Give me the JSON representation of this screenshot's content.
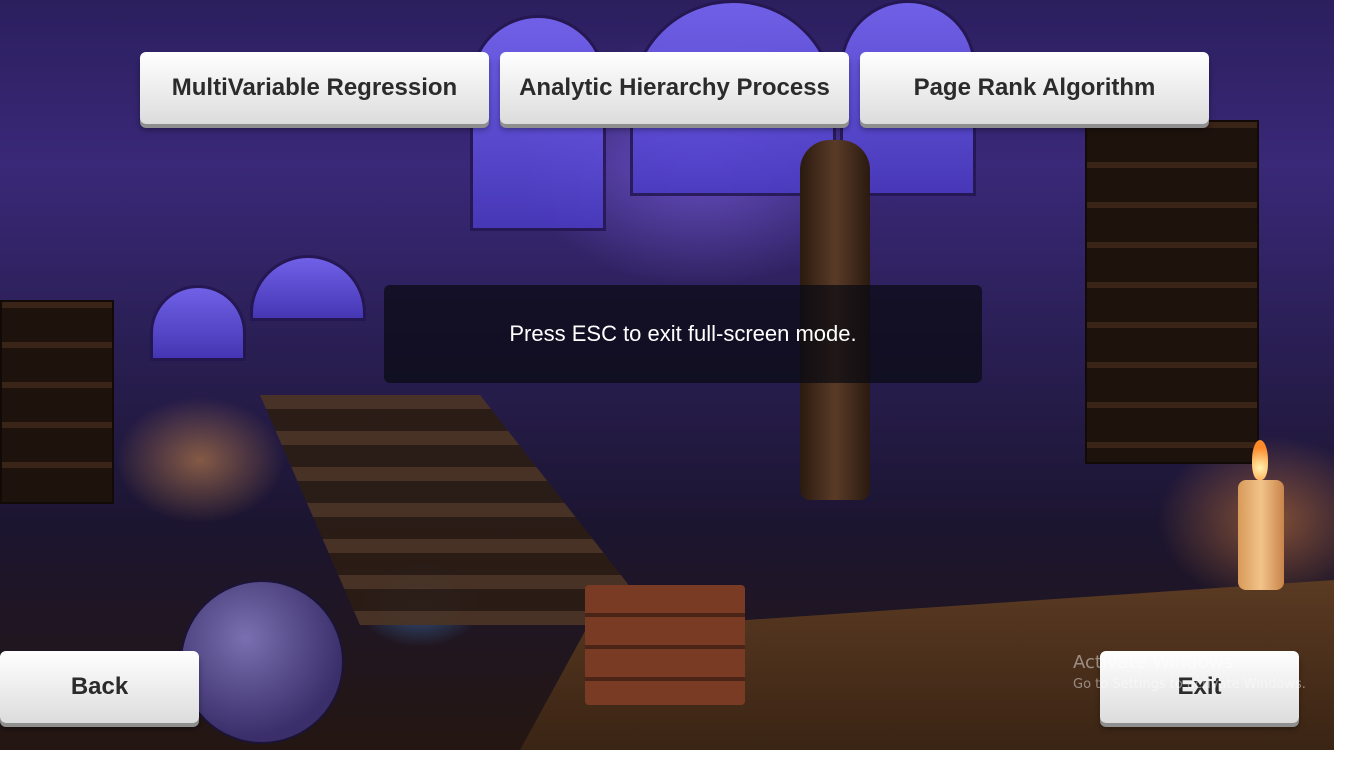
{
  "top_buttons": {
    "multivariable_regression": "MultiVariable Regression",
    "analytic_hierarchy_process": "Analytic Hierarchy Process",
    "page_rank_algorithm": "Page Rank Algorithm"
  },
  "toast": {
    "message": "Press ESC to exit full-screen mode."
  },
  "bottom_buttons": {
    "back": "Back",
    "exit": "Exit"
  },
  "watermark": {
    "title": "Activate Windows",
    "subtitle": "Go to Settings to activate Windows."
  }
}
